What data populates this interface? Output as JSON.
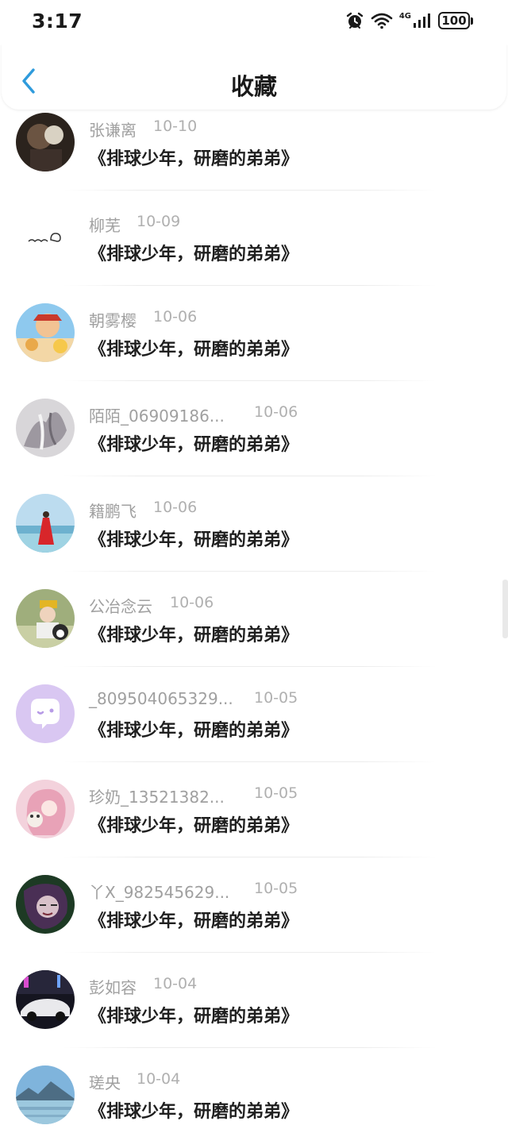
{
  "status_bar": {
    "time": "3:17",
    "network": "4G",
    "battery": "100"
  },
  "header": {
    "title": "收藏"
  },
  "items": [
    {
      "name": "张谦离",
      "date": "10-10",
      "title": "《排球少年，研磨的弟弟》"
    },
    {
      "name": "柳芜",
      "date": "10-09",
      "title": "《排球少年，研磨的弟弟》"
    },
    {
      "name": "朝雾樱",
      "date": "10-06",
      "title": "《排球少年，研磨的弟弟》"
    },
    {
      "name": "陌陌_06909186...",
      "date": "10-06",
      "title": "《排球少年，研磨的弟弟》"
    },
    {
      "name": "籍鹏飞",
      "date": "10-06",
      "title": "《排球少年，研磨的弟弟》"
    },
    {
      "name": "公冶念云",
      "date": "10-06",
      "title": "《排球少年，研磨的弟弟》"
    },
    {
      "name": "_809504065329...",
      "date": "10-05",
      "title": "《排球少年，研磨的弟弟》"
    },
    {
      "name": "珍奶_13521382...",
      "date": "10-05",
      "title": "《排球少年，研磨的弟弟》"
    },
    {
      "name": "丫X_982545629...",
      "date": "10-05",
      "title": "《排球少年，研磨的弟弟》"
    },
    {
      "name": "彭如容",
      "date": "10-04",
      "title": "《排球少年，研磨的弟弟》"
    },
    {
      "name": "瑳央",
      "date": "10-04",
      "title": "《排球少年，研磨的弟弟》"
    }
  ]
}
